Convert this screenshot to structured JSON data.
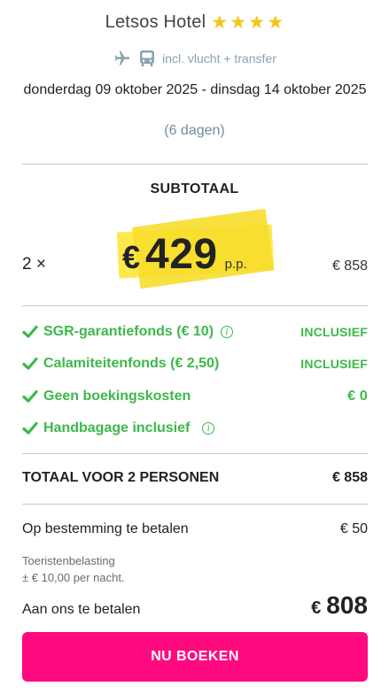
{
  "hotel": {
    "name": "Letsos Hotel",
    "stars": 4
  },
  "includes": {
    "text": "incl. vlucht + transfer",
    "icons": [
      "plane-icon",
      "bus-icon"
    ]
  },
  "dates": {
    "range": "donderdag 09 oktober 2025 - dinsdag 14 oktober 2025",
    "duration": "(6 dagen)"
  },
  "subtotal": {
    "title": "SUBTOTAAL",
    "quantity": "2 ×",
    "price_currency": "€",
    "price_value": "429",
    "price_unit": "p.p.",
    "line_total": "€ 858"
  },
  "inclusions": [
    {
      "label": "SGR-garantiefonds  (€ 10)",
      "value": "INCLUSIEF",
      "info": true
    },
    {
      "label": "Calamiteitenfonds  (€ 2,50)",
      "value": "INCLUSIEF",
      "info": false
    },
    {
      "label": "Geen boekingskosten",
      "value": "€ 0",
      "info": false
    },
    {
      "label": "Handbagage inclusief",
      "value": "",
      "info": true
    }
  ],
  "total": {
    "label": "TOTAAL VOOR 2 PERSONEN",
    "value": "€ 858"
  },
  "destination": {
    "label": "Op bestemming te betalen",
    "value": "€ 50",
    "note_line1": "Toeristenbelasting",
    "note_line2": "± € 10,00 per nacht."
  },
  "pay": {
    "label": "Aan ons te betalen",
    "currency": "€",
    "value": "808"
  },
  "book_button": {
    "label": "NU BOEKEN"
  },
  "colors": {
    "accent_pink": "#ff0a7f",
    "green": "#3db84b",
    "star": "#f5c518",
    "highlight": "#fde94a"
  }
}
